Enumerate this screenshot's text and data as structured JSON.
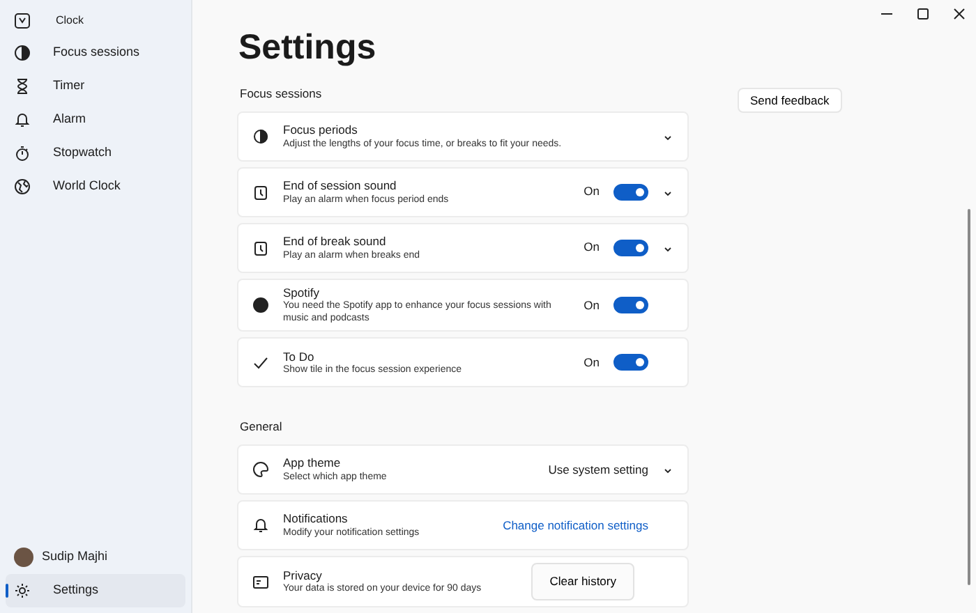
{
  "app_title": "Clock",
  "sidebar": {
    "items": [
      {
        "label": "Focus sessions",
        "selected": false
      },
      {
        "label": "Timer",
        "selected": false
      },
      {
        "label": "Alarm",
        "selected": false
      },
      {
        "label": "Stopwatch",
        "selected": false
      },
      {
        "label": "World Clock",
        "selected": false
      }
    ],
    "user": {
      "name": "Sudip Majhi"
    },
    "footer_items": [
      {
        "label": "Settings",
        "selected": true
      }
    ]
  },
  "page_title": "Settings",
  "feedback_button": "Send feedback",
  "sections": [
    {
      "heading": "Focus sessions",
      "rows": [
        {
          "kind": "expander",
          "title": "Focus periods",
          "description": "Adjust the lengths of your focus time, or breaks to fit your needs."
        },
        {
          "kind": "toggle",
          "title": "End of session sound",
          "description": "Play an alarm when focus period ends",
          "state_label": "On",
          "on": true,
          "expandable": true
        },
        {
          "kind": "toggle",
          "title": "End of break sound",
          "description": "Play an alarm when breaks end",
          "state_label": "On",
          "on": true,
          "expandable": true
        },
        {
          "kind": "toggle",
          "title": "Spotify",
          "description": "You need the Spotify app to enhance your focus sessions with music and podcasts",
          "state_label": "On",
          "on": true,
          "expandable": false
        },
        {
          "kind": "toggle",
          "title": "To Do",
          "description": "Show tile in the focus session experience",
          "state_label": "On",
          "on": true,
          "expandable": false
        }
      ]
    },
    {
      "heading": "General",
      "rows": [
        {
          "kind": "dropdown",
          "title": "App theme",
          "description": "Select which app theme",
          "value": "Use system setting"
        },
        {
          "kind": "link",
          "title": "Notifications",
          "description": "Modify your notification settings",
          "link_text": "Change notification settings"
        },
        {
          "kind": "button",
          "title": "Privacy",
          "description": "Your data is stored on your device for 90 days",
          "button_label": "Clear history"
        }
      ]
    }
  ]
}
